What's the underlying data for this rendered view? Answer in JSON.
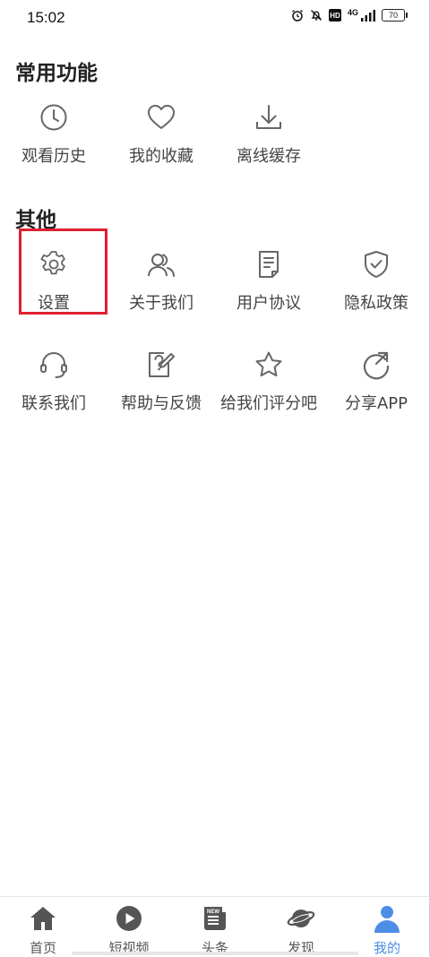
{
  "status_bar": {
    "time": "15:02",
    "network_label": "4G",
    "hd_label": "HD",
    "battery_level": "70"
  },
  "common_section": {
    "title": "常用功能",
    "items": [
      {
        "label": "观看历史",
        "icon": "clock-icon"
      },
      {
        "label": "我的收藏",
        "icon": "heart-icon"
      },
      {
        "label": "离线缓存",
        "icon": "download-icon"
      }
    ]
  },
  "other_section": {
    "title": "其他",
    "items": [
      {
        "label": "设置",
        "icon": "gear-icon"
      },
      {
        "label": "关于我们",
        "icon": "users-icon"
      },
      {
        "label": "用户协议",
        "icon": "document-icon"
      },
      {
        "label": "隐私政策",
        "icon": "shield-check-icon"
      },
      {
        "label": "联系我们",
        "icon": "headset-icon"
      },
      {
        "label": "帮助与反馈",
        "icon": "help-edit-icon"
      },
      {
        "label": "给我们评分吧",
        "icon": "star-icon"
      },
      {
        "label": "分享APP",
        "icon": "share-arrow-icon"
      }
    ]
  },
  "tab_bar": {
    "tabs": [
      {
        "label": "首页",
        "icon": "home-icon",
        "active": false
      },
      {
        "label": "短视频",
        "icon": "play-circle-icon",
        "active": false
      },
      {
        "label": "头条",
        "icon": "newspaper-icon",
        "active": false
      },
      {
        "label": "发现",
        "icon": "planet-icon",
        "active": false
      },
      {
        "label": "我的",
        "icon": "user-icon",
        "active": true
      }
    ]
  },
  "colors": {
    "accent": "#4d8de6",
    "highlight_border": "#e02030",
    "icon_stroke": "#666666"
  }
}
